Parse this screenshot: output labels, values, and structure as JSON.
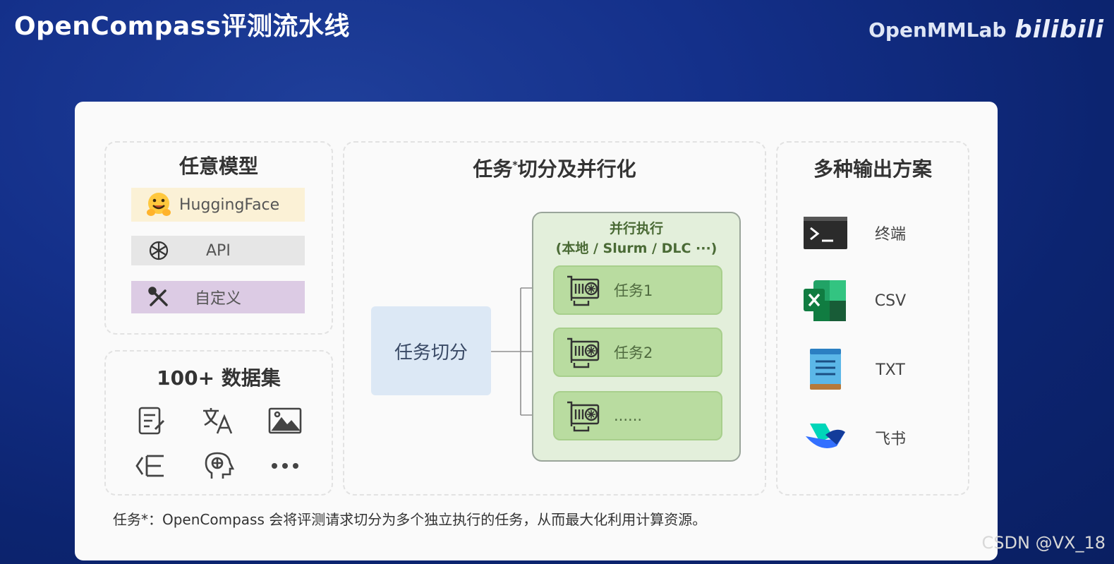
{
  "slide_title": "OpenCompass评测流水线",
  "brand": {
    "name": "OpenMMLab",
    "platform": "bilibili"
  },
  "watermark": "CSDN @VX_18",
  "models": {
    "title": "任意模型",
    "items": [
      {
        "label": "HuggingFace",
        "icon": "hugging-face-emoji-icon",
        "bg": "#fbf1d6"
      },
      {
        "label": "API",
        "icon": "openai-logo-icon",
        "bg": "#e6e6e6"
      },
      {
        "label": "自定义",
        "icon": "tools-icon",
        "bg": "#dccbe4"
      }
    ]
  },
  "datasets": {
    "title": "100+ 数据集",
    "icons": [
      "exam-paper-icon",
      "translate-icon",
      "image-icon",
      "list-icon",
      "head-brain-icon",
      "more-icon"
    ]
  },
  "task_split": {
    "title": "任务",
    "title_rest": "切分及并行化",
    "asterisk": "*",
    "split_label": "任务切分",
    "exec_title": "并行执行",
    "exec_subtitle": "(本地 / Slurm / DLC ···)",
    "tasks": [
      "任务1",
      "任务2",
      "......"
    ]
  },
  "outputs": {
    "title": "多种输出方案",
    "items": [
      {
        "label": "终端",
        "icon": "terminal-icon"
      },
      {
        "label": "CSV",
        "icon": "excel-icon"
      },
      {
        "label": "TXT",
        "icon": "notepad-icon"
      },
      {
        "label": "飞书",
        "icon": "feishu-icon"
      }
    ]
  },
  "footnote": "任务*：OpenCompass 会将评测请求切分为多个独立执行的任务，从而最大化利用计算资源。",
  "colors": {
    "background": "#14308a",
    "exec_green": "#e3efdb",
    "task_green": "#b9dca0",
    "split_blue": "#dce8f5"
  }
}
